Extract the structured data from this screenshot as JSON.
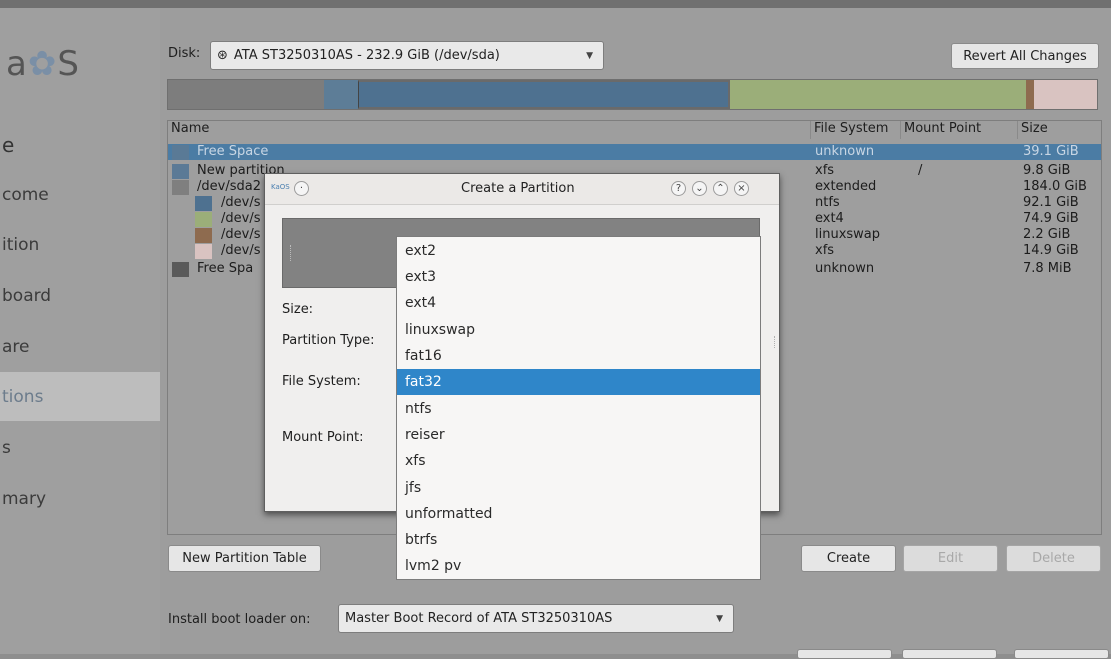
{
  "sidebar": {
    "logo": "a",
    "logo_tail": "S",
    "heading": "e",
    "items": [
      {
        "label": "come"
      },
      {
        "label": "ition"
      },
      {
        "label": "board"
      },
      {
        "label": "are"
      },
      {
        "label": "tions"
      },
      {
        "label": "s"
      },
      {
        "label": "mary"
      }
    ]
  },
  "disk": {
    "label": "Disk:",
    "selected": "ATA ST3250310AS - 232.9 GiB (/dev/sda)",
    "revert_label": "Revert All Changes"
  },
  "partition_bar": {
    "segments": [
      {
        "color": "#7d7d7d"
      },
      {
        "color": "#5d7d97"
      },
      {
        "color": "#4e7190"
      },
      {
        "color": "#9bae79"
      },
      {
        "color": "#8e6b4f"
      },
      {
        "color": "#d9c3c1"
      }
    ]
  },
  "table": {
    "headers": [
      "Name",
      "File System",
      "Mount Point",
      "Size"
    ],
    "rows": [
      {
        "name": "Free Space",
        "fs": "unknown",
        "mount": "",
        "size": "39.1 GiB",
        "color": "#5a7a96"
      },
      {
        "name": "New partition",
        "fs": "xfs",
        "mount": "/",
        "size": "9.8 GiB",
        "color": "#5b7a96"
      },
      {
        "name": "/dev/sda2",
        "fs": "extended",
        "mount": "",
        "size": "184.0 GiB",
        "color": "#7f7f7f"
      },
      {
        "name": "/dev/s",
        "fs": "ntfs",
        "mount": "",
        "size": "92.1 GiB",
        "color": "#4e7190"
      },
      {
        "name": "/dev/s",
        "fs": "ext4",
        "mount": "",
        "size": "74.9 GiB",
        "color": "#9bae79"
      },
      {
        "name": "/dev/s",
        "fs": "linuxswap",
        "mount": "",
        "size": "2.2 GiB",
        "color": "#8e6b4f"
      },
      {
        "name": "/dev/s",
        "fs": "xfs",
        "mount": "",
        "size": "14.9 GiB",
        "color": "#d9c3c1"
      },
      {
        "name": "Free Spa",
        "fs": "unknown",
        "mount": "",
        "size": "7.8 MiB",
        "color": "#5a5a5a"
      }
    ]
  },
  "buttons": {
    "new_table": "New Partition Table",
    "create": "Create",
    "edit": "Edit",
    "delete": "Delete"
  },
  "bootloader": {
    "label": "Install boot loader on:",
    "selected": "Master Boot Record of ATA ST3250310AS"
  },
  "dialog": {
    "title": "Create a Partition",
    "app_badge": "KaOS",
    "size_label": "Size:",
    "type_label": "Partition Type:",
    "fs_label": "File System:",
    "mount_label": "Mount Point:"
  },
  "fs_options": {
    "selected": "fat32",
    "items": [
      "ext2",
      "ext3",
      "ext4",
      "linuxswap",
      "fat16",
      "fat32",
      "ntfs",
      "reiser",
      "xfs",
      "jfs",
      "unformatted",
      "btrfs",
      "lvm2 pv"
    ]
  }
}
